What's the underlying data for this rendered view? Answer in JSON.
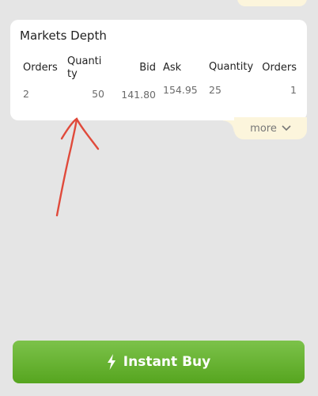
{
  "depth": {
    "title": "Markets Depth",
    "headers": {
      "orders_left": "Orders",
      "quantity_left": "Quantity",
      "bid": "Bid",
      "ask": "Ask",
      "quantity_right": "Quantity",
      "orders_right": "Orders"
    },
    "rows": [
      {
        "orders_left": "2",
        "quantity_left": "50",
        "bid": "141.80",
        "ask": "154.95",
        "quantity_right": "25",
        "orders_right": "1"
      }
    ],
    "more_label": "more"
  },
  "actions": {
    "buy_label": "Instant Buy"
  },
  "icons": {
    "more": "chevron-down-icon",
    "buy": "lightning-bolt-icon"
  },
  "colors": {
    "annotation": "#e04a3b",
    "button": "#62ad2b",
    "more_tab": "#fcf5dc"
  }
}
